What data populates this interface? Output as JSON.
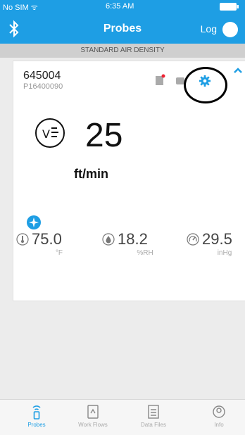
{
  "status_bar": {
    "carrier": "No SIM ᯤ",
    "time": "6:35 AM"
  },
  "navbar": {
    "title": "Probes",
    "log_label": "Log"
  },
  "banner": {
    "text": "STANDARD AIR DENSITY"
  },
  "probe": {
    "serial": "645004",
    "model": "P16400090",
    "reading": "25",
    "unit": "ft/min",
    "temperature": {
      "value": "75.0",
      "unit": "°F"
    },
    "humidity": {
      "value": "18.2",
      "unit": "%RH"
    },
    "pressure": {
      "value": "29.5",
      "unit": "inHg"
    }
  },
  "tabs": [
    {
      "label": "Probes",
      "active": true
    },
    {
      "label": "Work Flows",
      "active": false
    },
    {
      "label": "Data Files",
      "active": false
    },
    {
      "label": "Info",
      "active": false
    }
  ],
  "colors": {
    "accent": "#1e9ee4",
    "highlight_ring": "#000000"
  }
}
